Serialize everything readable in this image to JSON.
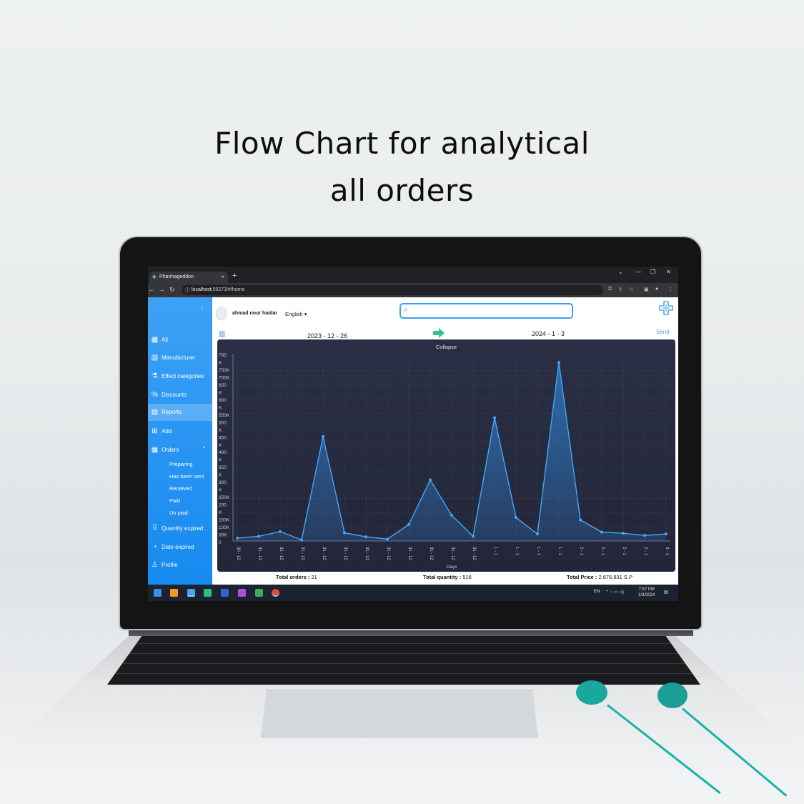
{
  "headline": {
    "line1": "Flow Chart for analytical",
    "line2": "all orders"
  },
  "browser": {
    "tab_title": "Pharmageddon",
    "new_tab": "+",
    "url_host": "localhost",
    "url_path": ":50273/#/home"
  },
  "sidebar": {
    "items": [
      {
        "label": "All",
        "icon": "grid-icon"
      },
      {
        "label": "Manufacturer",
        "icon": "building-icon"
      },
      {
        "label": "Effect categories",
        "icon": "flask-icon"
      },
      {
        "label": "Discounts",
        "icon": "percent-icon"
      },
      {
        "label": "Reports",
        "icon": "report-icon"
      },
      {
        "label": "Add",
        "icon": "add-icon"
      },
      {
        "label": "Orders",
        "icon": "orders-icon"
      }
    ],
    "order_subitems": [
      "Preparing",
      "Has been sent",
      "Received",
      "Paid",
      "Un paid"
    ],
    "items_after": [
      {
        "label": "Quantity expired",
        "icon": "quantity-icon"
      },
      {
        "label": "Date expired",
        "icon": "calendar-icon"
      },
      {
        "label": "Profile",
        "icon": "person-icon"
      }
    ],
    "active_item": "Reports"
  },
  "header": {
    "user_name": "ahmad nour haidar",
    "language": "English",
    "search_placeholder": ""
  },
  "filter": {
    "date_from": "2023 - 12 - 26",
    "date_to": "2024 - 1 - 3",
    "send_label": "Send"
  },
  "chart_data": {
    "type": "area",
    "title": "Collapse",
    "xlabel": "Days",
    "ylabel": "",
    "categories": [
      "30 - 12",
      "31 - 12",
      "31 - 12",
      "31 - 12",
      "31 - 12",
      "31 - 12",
      "31 - 12",
      "31 - 12",
      "31 - 12",
      "31 - 12",
      "31 - 12",
      "31 - 12",
      "1 - 1",
      "1 - 1",
      "1 - 1",
      "1 - 1",
      "2 - 1",
      "2 - 1",
      "2 - 1",
      "2 - 1",
      "3 - 1"
    ],
    "values": [
      12000,
      20000,
      40000,
      5000,
      445000,
      35000,
      18000,
      8000,
      70000,
      260000,
      110000,
      20000,
      525000,
      100000,
      30000,
      760000,
      90000,
      38000,
      33000,
      24000,
      30000
    ],
    "ylim": [
      0,
      785000
    ],
    "y_tick_labels": [
      "785",
      "K",
      "750K",
      "700K",
      "650",
      "K",
      "600",
      "K",
      "550K",
      "500",
      "K",
      "450",
      "K",
      "400",
      "K",
      "350",
      "K",
      "300",
      "K",
      "250K",
      "200",
      "K",
      "150K",
      "100K",
      "50K",
      "0"
    ],
    "grid": true,
    "colors": {
      "line": "#3fa8ff",
      "fill": "#2f7fd0",
      "background": "#262a3e",
      "grid": "#454a63"
    }
  },
  "stats": {
    "orders_label": "Total orders :",
    "orders_value": "21",
    "quantity_label": "Total quantity :",
    "quantity_value": "516",
    "price_label": "Total Price :",
    "price_value": "2,676,831 S.P"
  },
  "taskbar": {
    "lang": "EN",
    "time": "7:57 PM",
    "date": "1/3/2024"
  }
}
